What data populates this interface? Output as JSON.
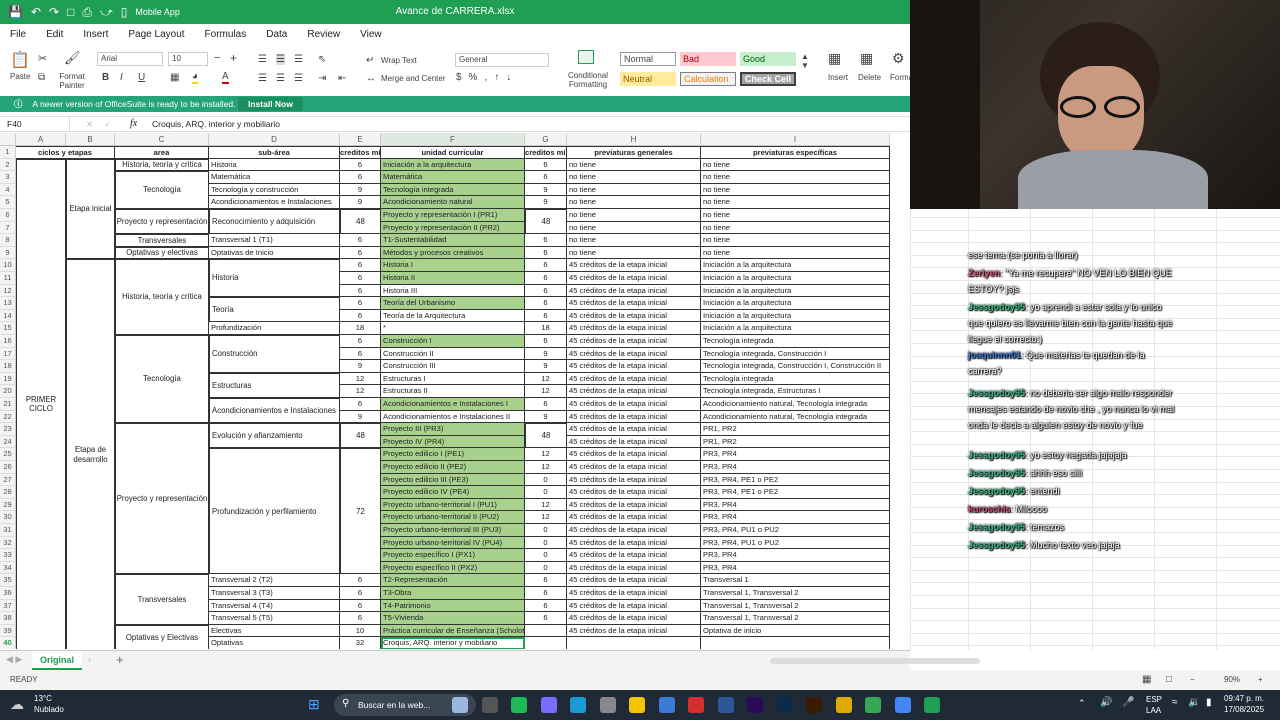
{
  "app": {
    "title": "Avance de CARRERA.xlsx",
    "mode": "Mobile App"
  },
  "menu": [
    "File",
    "Edit",
    "Insert",
    "Page Layout",
    "Formulas",
    "Data",
    "Review",
    "View"
  ],
  "ribbon": {
    "paste": "Paste",
    "format_painter": "Format Painter",
    "font": "Arial",
    "size": "10",
    "wrap_text": "Wrap Text",
    "merge_center": "Merge and Center",
    "number_format": "General",
    "conditional": "Conditional Formatting",
    "styles": {
      "normal": "Normal",
      "bad": "Bad",
      "good": "Good",
      "neutral": "Neutral",
      "calculation": "Calculation",
      "check_cell": "Check Cell"
    },
    "insert": "Insert",
    "delete": "Delete",
    "format": "Forma"
  },
  "notice": {
    "text": "A newer version of OfficeSuite is ready to be installed.",
    "button": "Install Now"
  },
  "formula_bar": {
    "cell_ref": "F40",
    "fx": "fx",
    "content": "Croquis, ARQ. interior y mobiliario"
  },
  "columns": [
    "A",
    "B",
    "C",
    "D",
    "E",
    "F",
    "G",
    "H",
    "I"
  ],
  "header_row": {
    "a": "ciclos y etapas",
    "c": "area",
    "d": "sub-área",
    "e": "creditos mínimos",
    "f": "unidad curricular",
    "g": "creditos mínimos",
    "h": "previaturas generales",
    "i": "previaturas específicas"
  },
  "merged": {
    "a_primer": "PRIMER CICLO",
    "b_inicial": "Etapa inicial",
    "b_desarrollo": "Etapa de desarrollo",
    "c": [
      "Historia, teoría y crítica",
      "Tecnología",
      "Proyecto y representación",
      "Transversales",
      "Optativas y electivas",
      "Historia, teoría y crítica",
      "Tecnología",
      "Proyecto y representación",
      "Transversales",
      "Optativas y Electivas"
    ],
    "d": [
      "Historia",
      "Teoría",
      "Construcción",
      "Estructuras",
      "Acondicionamientos e Instalaciones",
      "Evolución y afianzamiento",
      "Profundización y perfilamiento",
      "Reconocimiento y adquisición"
    ],
    "e": [
      "48",
      "48",
      "72"
    ],
    "g": [
      "48",
      "48"
    ]
  },
  "rows": [
    {
      "n": "2",
      "d": "Historia",
      "e": "6",
      "f": "Iniciación a la arquitectura",
      "g": "6",
      "h": "no tiene",
      "i": "no tiene",
      "green": true
    },
    {
      "n": "3",
      "d": "Matemática",
      "e": "6",
      "f": "Matemática",
      "g": "6",
      "h": "no tiene",
      "i": "no tiene",
      "green": true
    },
    {
      "n": "4",
      "d": "Tecnología y construcción",
      "e": "9",
      "f": "Tecnología integrada",
      "g": "9",
      "h": "no tiene",
      "i": "no tiene",
      "green": true
    },
    {
      "n": "5",
      "d": "Acondicionamientos e Instalaciones",
      "e": "9",
      "f": "Acondicionamiento natural",
      "g": "9",
      "h": "no tiene",
      "i": "no tiene",
      "green": true
    },
    {
      "n": "6",
      "d": "",
      "e": "",
      "f": "Proyecto y representación I (PR1)",
      "g": "",
      "h": "no tiene",
      "i": "no tiene",
      "green": true
    },
    {
      "n": "7",
      "d": "",
      "e": "",
      "f": "Proyecto y representación II (PR2)",
      "g": "",
      "h": "no tiene",
      "i": "no tiene",
      "green": true
    },
    {
      "n": "8",
      "d": "Transversal 1 (T1)",
      "e": "6",
      "f": "T1-Sustentabilidad",
      "g": "6",
      "h": "no tiene",
      "i": "no tiene",
      "green": true
    },
    {
      "n": "9",
      "d": "Optativas de Inicio",
      "e": "6",
      "f": "Métodos y procesos creativos",
      "g": "6",
      "h": "no tiene",
      "i": "no tiene",
      "green": true
    },
    {
      "n": "10",
      "d": "",
      "e": "6",
      "f": "Historia I",
      "g": "6",
      "h": "45 créditos de la etapa inicial",
      "i": "Iniciación a la arquitectura",
      "green": true
    },
    {
      "n": "11",
      "d": "",
      "e": "6",
      "f": "Historia II",
      "g": "6",
      "h": "45 créditos de la etapa inicial",
      "i": "Iniciación a la arquitectura",
      "green": true
    },
    {
      "n": "12",
      "d": "",
      "e": "6",
      "f": "Historia III",
      "g": "6",
      "h": "45 créditos de la etapa inicial",
      "i": "Iniciación a la arquitectura",
      "green": false
    },
    {
      "n": "13",
      "d": "",
      "e": "6",
      "f": "Teoría del Urbanismo",
      "g": "6",
      "h": "45 créditos de la etapa inicial",
      "i": "Iniciación a la arquitectura",
      "green": true
    },
    {
      "n": "14",
      "d": "",
      "e": "6",
      "f": "Teoría de la Arquitectura",
      "g": "6",
      "h": "45 créditos de la etapa inicial",
      "i": "Iniciación a la arquitectura",
      "green": false
    },
    {
      "n": "15",
      "d": "Profundización",
      "e": "18",
      "f": "*",
      "g": "18",
      "h": "45 créditos de la etapa inicial",
      "i": "Iniciación a la arquitectura",
      "green": false
    },
    {
      "n": "16",
      "d": "",
      "e": "6",
      "f": "Construcción I",
      "g": "6",
      "h": "45 créditos de la etapa inicial",
      "i": "Tecnología integrada",
      "green": true
    },
    {
      "n": "17",
      "d": "",
      "e": "6",
      "f": "Construcción II",
      "g": "9",
      "h": "45 créditos de la etapa inicial",
      "i": "Tecnología integrada, Construcción I",
      "green": false
    },
    {
      "n": "18",
      "d": "",
      "e": "9",
      "f": "Construcción III",
      "g": "9",
      "h": "45 créditos de la etapa inicial",
      "i": "Tecnología integrada, Construcción I, Construcción II",
      "green": false
    },
    {
      "n": "19",
      "d": "",
      "e": "12",
      "f": "Estructuras I",
      "g": "12",
      "h": "45 créditos de la etapa inicial",
      "i": "Tecnología integrada",
      "green": false
    },
    {
      "n": "20",
      "d": "",
      "e": "12",
      "f": "Estructuras II",
      "g": "12",
      "h": "45 créditos de la etapa inicial",
      "i": "Tecnología integrada, Estructuras I",
      "green": false
    },
    {
      "n": "21",
      "d": "",
      "e": "6",
      "f": "Acondicionamientos e Instalaciones I",
      "g": "6",
      "h": "45 créditos de la etapa inicial",
      "i": "Acondicionamiento natural, Tecnología integrada",
      "green": true
    },
    {
      "n": "22",
      "d": "",
      "e": "9",
      "f": "Acondicionamientos e Instalaciones II",
      "g": "9",
      "h": "45 créditos de la etapa inicial",
      "i": "Acondicionamiento natural, Tecnología integrada",
      "green": false
    },
    {
      "n": "23",
      "d": "",
      "e": "",
      "f": "Proyecto III (PR3)",
      "g": "",
      "h": "45 créditos de la etapa inicial",
      "i": "PR1, PR2",
      "green": true
    },
    {
      "n": "24",
      "d": "",
      "e": "",
      "f": "Proyecto IV (PR4)",
      "g": "",
      "h": "45 créditos de la etapa inicial",
      "i": "PR1, PR2",
      "green": true
    },
    {
      "n": "25",
      "d": "",
      "e": "",
      "f": "Proyecto edilicio I (PE1)",
      "g": "12",
      "h": "45 créditos de la etapa inicial",
      "i": "PR3, PR4",
      "green": true
    },
    {
      "n": "26",
      "d": "",
      "e": "",
      "f": "Proyecto edilicio II (PE2)",
      "g": "12",
      "h": "45 créditos de la etapa inicial",
      "i": "PR3, PR4",
      "green": true
    },
    {
      "n": "27",
      "d": "",
      "e": "",
      "f": "Proyecto edilicio III (PE3)",
      "g": "0",
      "h": "45 créditos de la etapa inicial",
      "i": "PR3, PR4, PE1 o PE2",
      "green": true
    },
    {
      "n": "28",
      "d": "",
      "e": "",
      "f": "Proyecto edilicio IV (PE4)",
      "g": "0",
      "h": "45 créditos de la etapa inicial",
      "i": "PR3, PR4, PE1 o PE2",
      "green": true
    },
    {
      "n": "29",
      "d": "",
      "e": "",
      "f": "Proyecto urbano-territorial I (PU1)",
      "g": "12",
      "h": "45 créditos de la etapa inicial",
      "i": "PR3, PR4",
      "green": true
    },
    {
      "n": "30",
      "d": "",
      "e": "",
      "f": "Proyecto urbano-territorial II (PU2)",
      "g": "12",
      "h": "45 créditos de la etapa inicial",
      "i": "PR3, PR4",
      "green": true
    },
    {
      "n": "31",
      "d": "",
      "e": "",
      "f": "Proyecto urbano-territorial III (PU3)",
      "g": "0",
      "h": "45 créditos de la etapa inicial",
      "i": "PR3, PR4, PU1 o PU2",
      "green": true
    },
    {
      "n": "32",
      "d": "",
      "e": "",
      "f": "Proyecto urbano-territorial IV (PU4)",
      "g": "0",
      "h": "45 créditos de la etapa inicial",
      "i": "PR3, PR4, PU1 o PU2",
      "green": true
    },
    {
      "n": "33",
      "d": "",
      "e": "",
      "f": "Proyecto específico I (PX1)",
      "g": "0",
      "h": "45 créditos de la etapa inicial",
      "i": "PR3, PR4",
      "green": true
    },
    {
      "n": "34",
      "d": "",
      "e": "",
      "f": "Proyecto específico II (PX2)",
      "g": "0",
      "h": "45 créditos de la etapa inicial",
      "i": "PR3, PR4",
      "green": true
    },
    {
      "n": "35",
      "d": "Transversal 2 (T2)",
      "e": "6",
      "f": "T2-Representación",
      "g": "6",
      "h": "45 créditos de la etapa inicial",
      "i": "Transversal 1",
      "green": true
    },
    {
      "n": "36",
      "d": "Transversal 3 (T3)",
      "e": "6",
      "f": "T3-Obra",
      "g": "6",
      "h": "45 créditos de la etapa inicial",
      "i": "Transversal 1, Transversal 2",
      "green": true
    },
    {
      "n": "37",
      "d": "Transversal 4 (T4)",
      "e": "6",
      "f": "T4-Patrimonio",
      "g": "6",
      "h": "45 créditos de la etapa inicial",
      "i": "Transversal 1, Transversal 2",
      "green": true
    },
    {
      "n": "38",
      "d": "Transversal 5 (T5)",
      "e": "6",
      "f": "T5-Vivienda",
      "g": "6",
      "h": "45 créditos de la etapa inicial",
      "i": "Transversal 1, Transversal 2",
      "green": true
    },
    {
      "n": "39",
      "d": "Electivas",
      "e": "10",
      "f": "Práctica curricular de Enseñanza (Scholotto)",
      "g": "",
      "h": "45 créditos de la etapa inicial",
      "i": "Optativa de inicio",
      "green": true
    },
    {
      "n": "40",
      "d": "Optativas",
      "e": "32",
      "f": "Croquis, ARQ. interior y mobiliario",
      "g": "",
      "h": "",
      "i": "",
      "green": false
    }
  ],
  "sheet_tab": "Original",
  "status": {
    "ready": "READY",
    "zoom": "90%"
  },
  "taskbar": {
    "temp": "13°C",
    "weather": "Nublado",
    "search": "Buscar en la web...",
    "lang": "ESP",
    "lang2": "LAA",
    "time": "09:47 p. m.",
    "date": "17/08/2025"
  },
  "chat": [
    {
      "user": "",
      "text": "ese tema (se ponia a llorar)",
      "color": "#ffffff"
    },
    {
      "user": "Zeriyen",
      "text": ": \"Ya me recupere\" NO VEN LO BIEN QUE ESTOY? jsjs",
      "color": "#e0607e"
    },
    {
      "user": "Jessgodoy95",
      "text": ": yo aprendi a estar sola y lo unico que quiero es llevarme bien con la gente hasta que llegue el correcto:)",
      "color": "#3fbf8a"
    },
    {
      "user": "joaquinnn01",
      "text": ": Que materias te quedan de la carrera?",
      "color": "#3a7bd5"
    },
    {
      "user": "Jessgodoy95",
      "text": ": no deberia ser algo malo responder mensajes estando de novio che , yo nunca lo vi mal onda le decis a alguien estoy de novio y fue",
      "color": "#3fbf8a"
    },
    {
      "user": "Jessgodoy95",
      "text": ": yo estoy negada jajajaja",
      "color": "#3fbf8a"
    },
    {
      "user": "Jessgodoy95",
      "text": ": ahhh eso siiii",
      "color": "#3fbf8a"
    },
    {
      "user": "Jessgodoy95",
      "text": ": entendi",
      "color": "#3fbf8a"
    },
    {
      "user": "kuroschis",
      "text": ": Miloooo",
      "color": "#d0507a"
    },
    {
      "user": "Jessgodoy95",
      "text": ": temazos",
      "color": "#3fbf8a"
    },
    {
      "user": "Jessgodoy95",
      "text": ": Mucho texto veo jajaja",
      "color": "#3fbf8a"
    }
  ]
}
